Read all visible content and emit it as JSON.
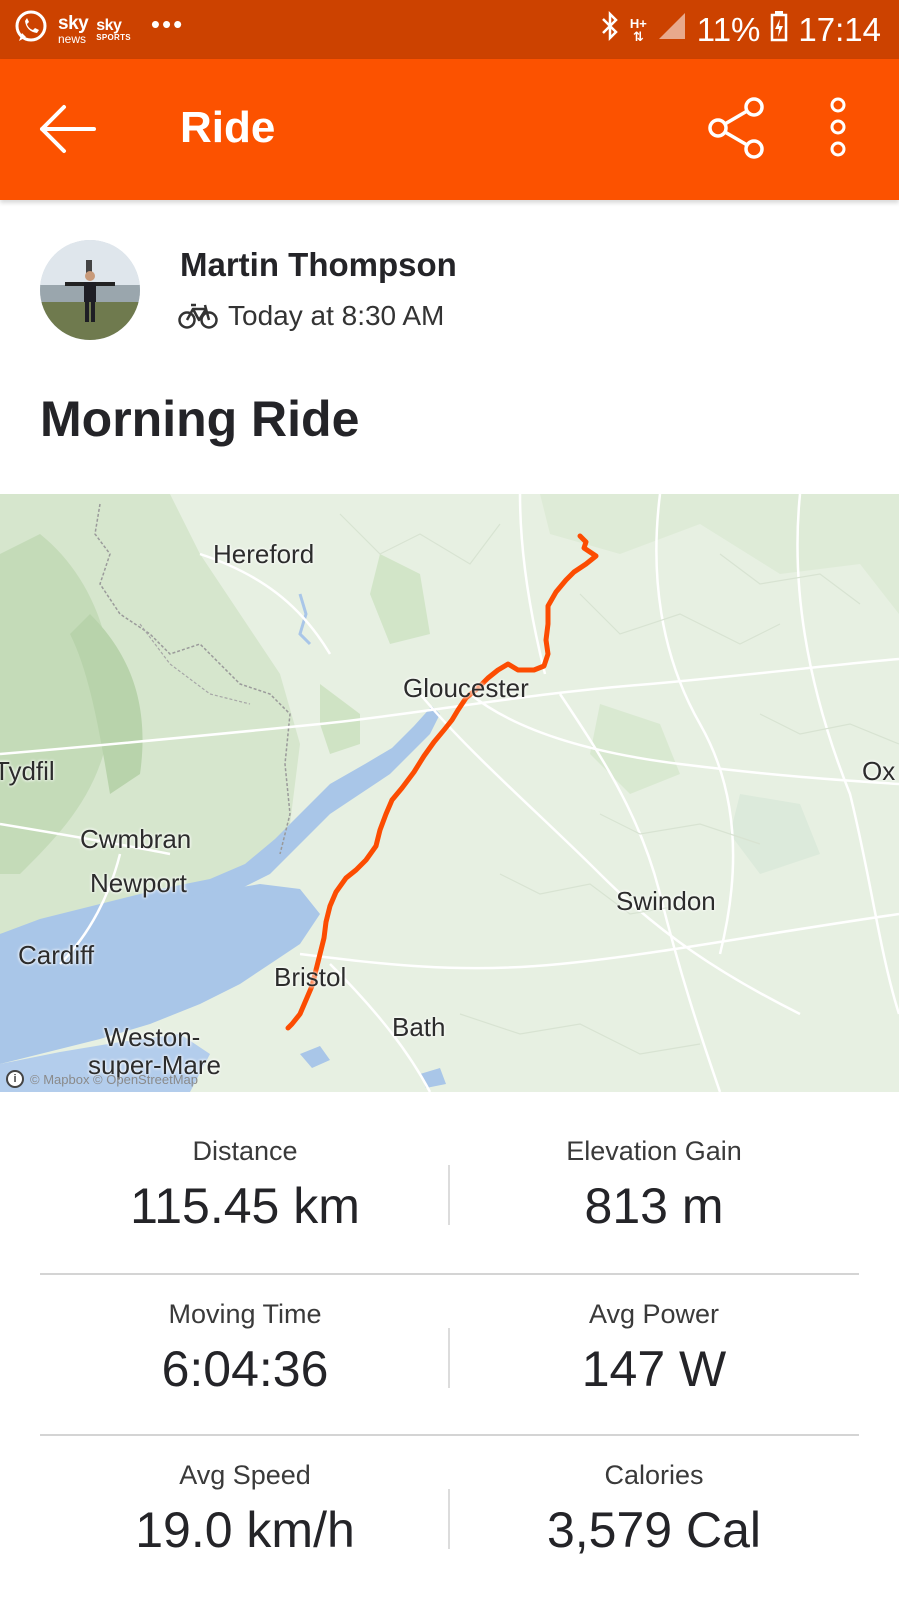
{
  "status_bar": {
    "notification_icons": [
      "whatsapp-icon",
      "sky-news-icon",
      "sky-sports-icon"
    ],
    "sky_news": {
      "top": "sky",
      "bottom": "news"
    },
    "sky_sports": {
      "top": "sky",
      "bottom": "SPORTS"
    },
    "more_indicator": "•••",
    "network": {
      "top": "H+",
      "bottom": "⇅"
    },
    "battery": "11%",
    "time": "17:14"
  },
  "app_bar": {
    "title": "Ride",
    "background": "#fc5200",
    "status_background": "#cc4200"
  },
  "activity": {
    "athlete_name": "Martin Thompson",
    "sport_icon": "bike-icon",
    "timestamp": "Today at 8:30 AM",
    "title": "Morning Ride"
  },
  "map": {
    "labels": {
      "hereford": "Hereford",
      "gloucester": "Gloucester",
      "tydfil": "Tydfil",
      "ox": "Ox",
      "cwmbran": "Cwmbran",
      "newport": "Newport",
      "swindon": "Swindon",
      "cardiff": "Cardiff",
      "bristol": "Bristol",
      "bath": "Bath",
      "weston": "Weston-",
      "super_mare": "super-Mare"
    },
    "attribution": "© Mapbox © OpenStreetMap",
    "route_color": "#fc4c02"
  },
  "stats": [
    {
      "label": "Distance",
      "value": "115.45 km"
    },
    {
      "label": "Elevation Gain",
      "value": "813 m"
    },
    {
      "label": "Moving Time",
      "value": "6:04:36"
    },
    {
      "label": "Avg Power",
      "value": "147 W"
    },
    {
      "label": "Avg Speed",
      "value": "19.0 km/h"
    },
    {
      "label": "Calories",
      "value": "3,579 Cal"
    }
  ]
}
